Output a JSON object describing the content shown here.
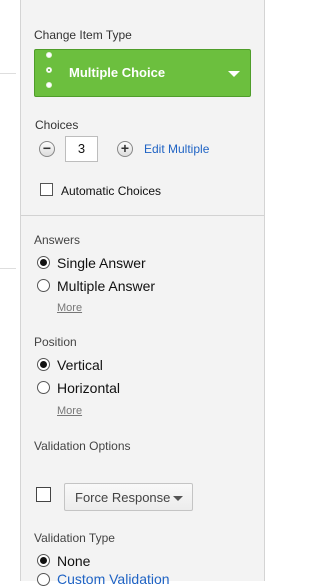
{
  "item_type": {
    "section_label": "Change Item Type",
    "selected": "Multiple Choice"
  },
  "choices": {
    "label": "Choices",
    "count": "3",
    "minus": "−",
    "plus": "+",
    "edit_multiple": "Edit Multiple",
    "automatic_choices": "Automatic Choices"
  },
  "answers": {
    "label": "Answers",
    "options": [
      "Single Answer",
      "Multiple Answer"
    ],
    "selected": "Single Answer",
    "more": "More"
  },
  "position": {
    "label": "Position",
    "options": [
      "Vertical",
      "Horizontal"
    ],
    "selected": "Vertical",
    "more": "More"
  },
  "validation_options": {
    "label": "Validation Options",
    "dropdown_value": "Force Response"
  },
  "validation_type": {
    "label": "Validation Type",
    "options": [
      "None",
      "Custom Validation"
    ],
    "selected": "None"
  },
  "colors": {
    "accent_green": "#6cbf3e",
    "link_blue": "#1f63c4"
  }
}
